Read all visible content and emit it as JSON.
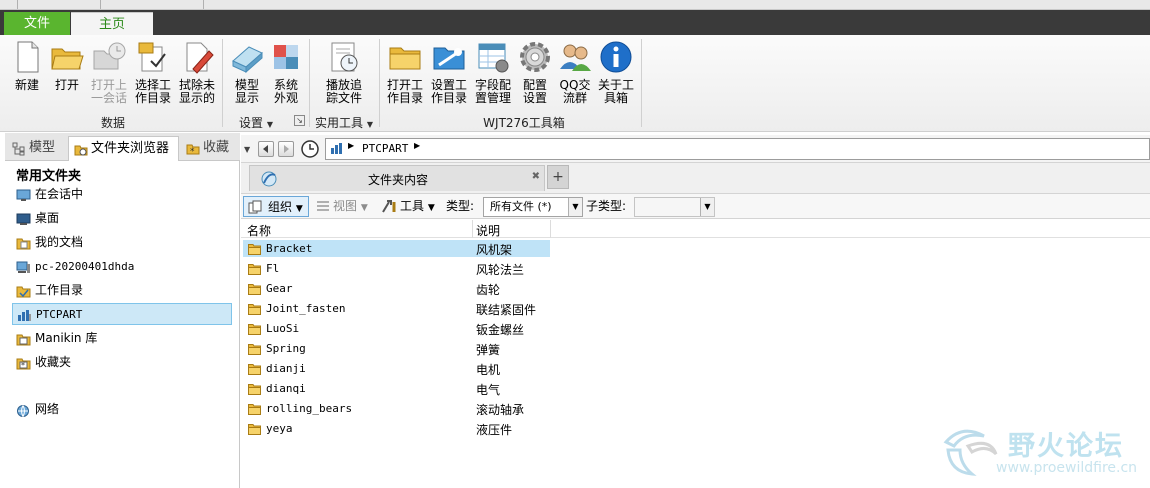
{
  "ribbon": {
    "tabs": [
      {
        "label": "文件"
      },
      {
        "label": "主页"
      }
    ],
    "groups": {
      "data": {
        "label": "数据",
        "buttons": [
          {
            "label": "新建"
          },
          {
            "label": "打开"
          },
          {
            "label": "打开上\n一会话"
          },
          {
            "label": "选择工\n作目录"
          },
          {
            "label": "拭除未\n显示的"
          }
        ]
      },
      "settings": {
        "label": "设置",
        "buttons": [
          {
            "label": "模型\n显示"
          },
          {
            "label": "系统\n外观"
          }
        ]
      },
      "utility": {
        "label": "实用工具",
        "buttons": [
          {
            "label": "播放追\n踪文件"
          }
        ]
      },
      "wjt": {
        "label": "WJT276工具箱",
        "buttons": [
          {
            "label": "打开工\n作目录"
          },
          {
            "label": "设置工\n作目录"
          },
          {
            "label": "字段配\n置管理"
          },
          {
            "label": "配置\n设置"
          },
          {
            "label": "QQ交\n流群"
          },
          {
            "label": "关于工\n具箱"
          }
        ]
      }
    }
  },
  "left_panel": {
    "tabs": [
      {
        "label": "模型"
      },
      {
        "label": "文件夹浏览器"
      },
      {
        "label": "收藏"
      }
    ],
    "heading": "常用文件夹",
    "items": [
      {
        "label": "在会话中"
      },
      {
        "label": "桌面"
      },
      {
        "label": "我的文档"
      },
      {
        "label": "pc-20200401dhda"
      },
      {
        "label": "工作目录"
      },
      {
        "label": "PTCPART"
      },
      {
        "label": "Manikin 库"
      },
      {
        "label": "收藏夹"
      },
      {
        "label": "网络"
      }
    ]
  },
  "browser": {
    "address": "PTCPART",
    "tab_title": "文件夹内容",
    "toolbar": {
      "organize": "组织",
      "view": "视图",
      "tools": "工具",
      "type_label": "类型:",
      "type_value": "所有文件 (*)",
      "subtype_label": "子类型:"
    },
    "columns": {
      "name": "名称",
      "desc": "说明"
    },
    "rows": [
      {
        "name": "Bracket",
        "desc": "风机架"
      },
      {
        "name": "Fl",
        "desc": "风轮法兰"
      },
      {
        "name": "Gear",
        "desc": "齿轮"
      },
      {
        "name": "Joint_fasten",
        "desc": "联结紧固件"
      },
      {
        "name": "LuoSi",
        "desc": "钣金螺丝"
      },
      {
        "name": "Spring",
        "desc": "弹簧"
      },
      {
        "name": "dianji",
        "desc": "电机"
      },
      {
        "name": "dianqi",
        "desc": "电气"
      },
      {
        "name": "rolling_bears",
        "desc": "滚动轴承"
      },
      {
        "name": "yeya",
        "desc": "液压件"
      }
    ]
  },
  "watermark": {
    "title": "野火论坛",
    "url": "www.proewildfire.cn"
  },
  "colors": {
    "file_tab": "#5ab52f",
    "selection": "#cde8f7",
    "folder": "#e9b93c"
  }
}
